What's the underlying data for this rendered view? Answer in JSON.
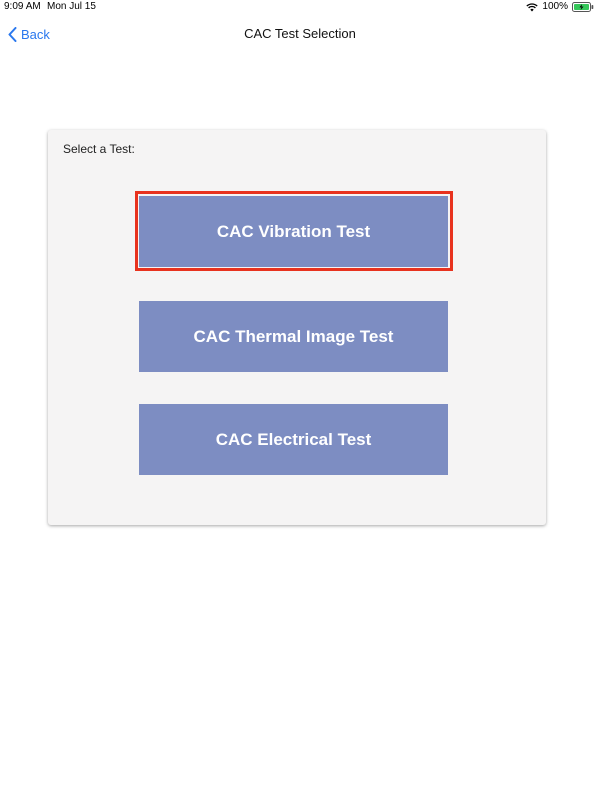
{
  "status_bar": {
    "time": "9:09 AM",
    "date": "Mon Jul 15",
    "battery_percent": "100%",
    "icons": [
      "wifi-icon",
      "battery-charging-icon"
    ]
  },
  "nav": {
    "back_label": "Back",
    "title": "CAC Test Selection"
  },
  "card": {
    "label": "Select a Test:",
    "buttons": [
      {
        "label": "CAC Vibration Test",
        "highlighted": true
      },
      {
        "label": "CAC Thermal Image Test",
        "highlighted": false
      },
      {
        "label": "CAC Electrical Test",
        "highlighted": false
      }
    ]
  },
  "colors": {
    "accent": "#2a78ee",
    "button_bg": "#7d8dc2",
    "card_bg": "#f5f4f4",
    "highlight_border": "#e8321e"
  }
}
